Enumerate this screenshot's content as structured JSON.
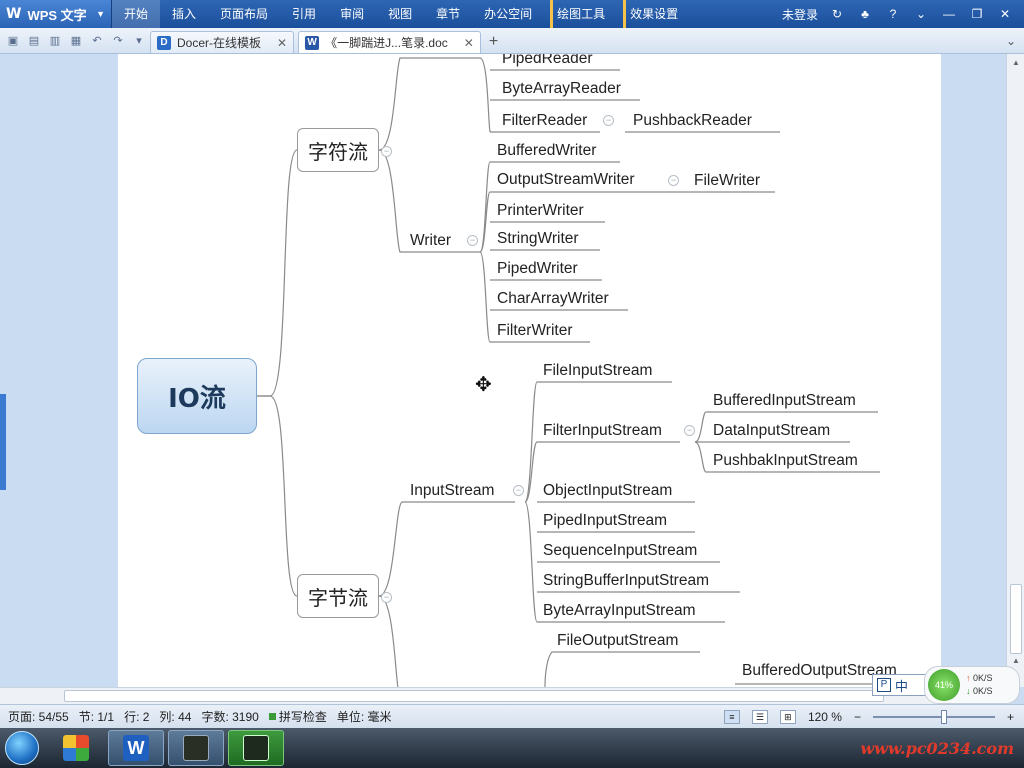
{
  "app": {
    "brand": "WPS 文字"
  },
  "menubar": {
    "items": [
      "开始",
      "插入",
      "页面布局",
      "引用",
      "审阅",
      "视图",
      "章节",
      "办公空间"
    ],
    "tools": [
      "绘图工具",
      "效果设置"
    ],
    "login": "未登录",
    "help": "?"
  },
  "tabs": [
    {
      "label": "Docer-在线模板",
      "icon": "D",
      "color": "#2b6cc7"
    },
    {
      "label": "《一脚踹进J...笔录.doc",
      "icon": "W",
      "color": "#2b58a6"
    }
  ],
  "mindmap": {
    "root": "IO流",
    "branch1": "字符流",
    "branch2": "字节流",
    "writer": "Writer",
    "inputstream": "InputStream",
    "reader_items": [
      "PipedReader",
      "ByteArrayReader",
      "FilterReader"
    ],
    "pushback": "PushbackReader",
    "writer_items": [
      "BufferedWriter",
      "OutputStreamWriter",
      "PrinterWriter",
      "StringWriter",
      "PipedWriter",
      "CharArrayWriter",
      "FilterWriter"
    ],
    "filewriter": "FileWriter",
    "input_items": [
      "FileInputStream",
      "FilterInputStream",
      "ObjectInputStream",
      "PipedInputStream",
      "SequenceInputStream",
      "StringBufferInputStream",
      "ByteArrayInputStream"
    ],
    "filter_children": [
      "BufferedInputStream",
      "DataInputStream",
      "PushbakInputStream"
    ],
    "output_items": [
      "FileOutputStream",
      "BufferedOutputStream"
    ]
  },
  "status": {
    "page": "页面: 54/55",
    "section": "节: 1/1",
    "row": "行: 2",
    "col": "列: 44",
    "words": "字数: 3190",
    "spell": "拼写检查",
    "unit": "单位: 毫米",
    "zoom": "120 %"
  },
  "ime": {
    "label": "中",
    "p": "P"
  },
  "net": {
    "percent": "41%",
    "up": "0K/S",
    "down": "0K/S"
  },
  "watermark": "www.pc0234.com"
}
